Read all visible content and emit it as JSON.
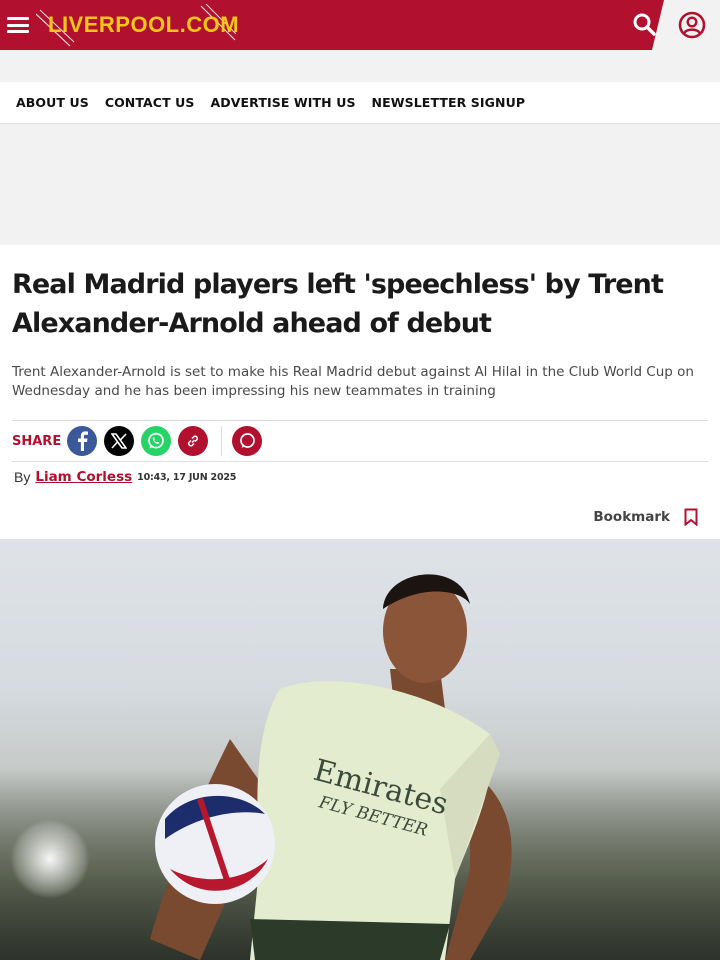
{
  "header": {
    "logo_text": "LIVERPOOL.COM",
    "brand_color": "#b1102f",
    "logo_color": "#f5c518",
    "menu_icon": "hamburger-menu-icon",
    "search_icon": "search-icon",
    "account_icon": "user-account-icon"
  },
  "subnav": {
    "items": [
      "ABOUT US",
      "CONTACT US",
      "ADVERTISE WITH US",
      "NEWSLETTER SIGNUP"
    ]
  },
  "article": {
    "headline": "Real Madrid players left 'speechless' by Trent Alexander-Arnold ahead of debut",
    "standfirst": "Trent Alexander-Arnold is set to make his Real Madrid debut against Al Hilal in the Club World Cup on Wednesday and he has been impressing his new teammates in training",
    "share": {
      "label": "SHARE",
      "buttons": [
        "facebook-icon",
        "x-icon",
        "whatsapp-icon",
        "link-icon",
        "comment-icon"
      ]
    },
    "byline": {
      "by": "By",
      "author": "Liam Corless",
      "timestamp": "10:43, 17 JUN 2025"
    },
    "bookmark": {
      "label": "Bookmark",
      "icon": "bookmark-icon"
    },
    "hero_image": "photo-player-kicking-ball"
  }
}
